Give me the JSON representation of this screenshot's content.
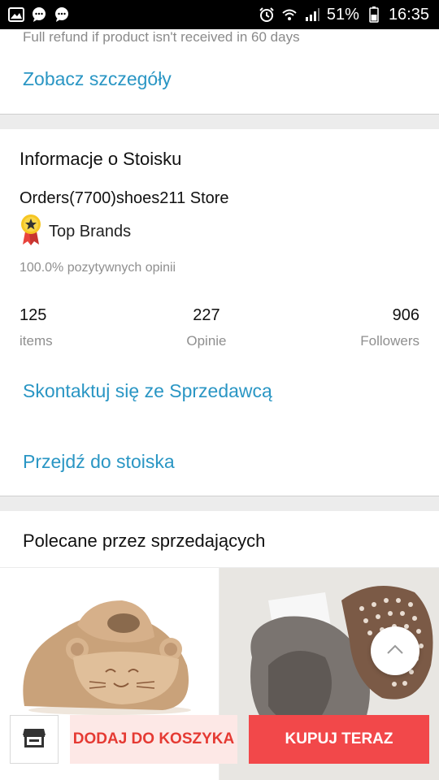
{
  "status_bar": {
    "battery": "51%",
    "time": "16:35",
    "left_icons": [
      "image-icon",
      "chat-icon",
      "chat-icon"
    ],
    "right_icons": [
      "alarm-icon",
      "wifi-icon",
      "signal-icon"
    ]
  },
  "refund": {
    "text": "Full refund if product isn't received in 60 days",
    "details_link": "Zobacz szczegóły"
  },
  "store": {
    "title": "Informacje o Stoisku",
    "name": "Orders(7700)shoes211 Store",
    "brand_badge": "Top Brands",
    "positive_feedback": "100.0% pozytywnych opinii",
    "stats": {
      "items_count": "125",
      "items_label": "items",
      "reviews_count": "227",
      "reviews_label": "Opinie",
      "followers_count": "906",
      "followers_label": "Followers"
    },
    "contact_link": "Skontaktuj się ze Sprzedawcą",
    "goto_store_link": "Przejdź do stoiska"
  },
  "recommended": {
    "title": "Polecane przez sprzedających"
  },
  "bottom_bar": {
    "add_to_cart": "DODAJ DO KOSZYKA",
    "buy_now": "KUPUJ TERAZ"
  },
  "colors": {
    "link": "#2a96c4",
    "buy_button": "#f2484a",
    "cart_button_bg": "#fde8e6",
    "cart_button_text": "#e53a33"
  }
}
